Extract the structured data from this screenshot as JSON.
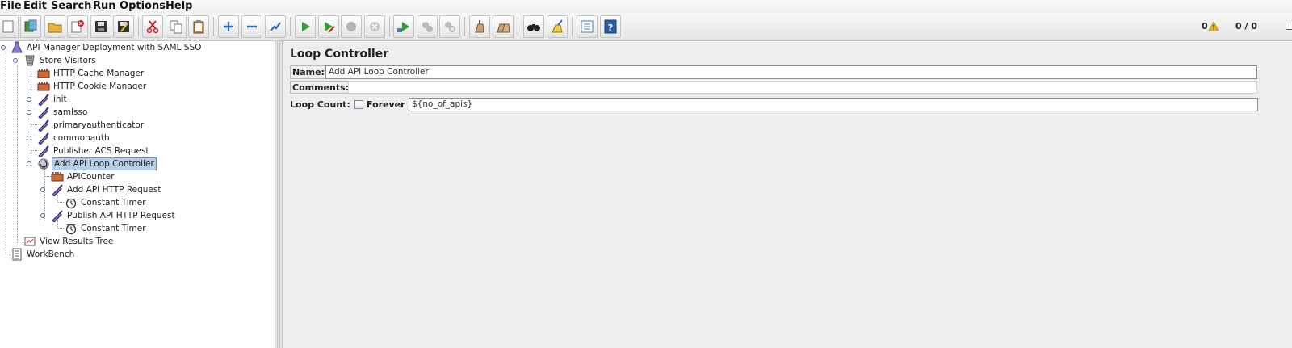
{
  "menu": [
    {
      "mnemonic": "F",
      "rest": "ile"
    },
    {
      "mnemonic": "E",
      "rest": "dit"
    },
    {
      "mnemonic": "S",
      "rest": "earch"
    },
    {
      "mnemonic": "R",
      "rest": "un"
    },
    {
      "mnemonic": "O",
      "rest": "ptions"
    },
    {
      "mnemonic": "H",
      "rest": "elp"
    }
  ],
  "toolbar": {
    "buttons": [
      "new-icon",
      "templates-icon",
      "open-icon",
      "close-icon",
      "save-icon",
      "save-as-icon",
      "cut-icon",
      "copy-icon",
      "paste-icon",
      "expand-icon",
      "collapse-icon",
      "toggle-icon",
      "start-icon",
      "start-no-pause-icon",
      "stop-icon",
      "shutdown-icon",
      "remote-start-icon",
      "remote-stop-icon",
      "remote-shutdown-icon",
      "clear-icon",
      "clear-all-icon",
      "search-icon",
      "reset-search-icon",
      "function-helper-icon",
      "help-icon"
    ],
    "errors_count": "0",
    "threads": "0 / 0"
  },
  "tree": {
    "nodes": [
      {
        "label": "API Manager Deployment with SAML SSO",
        "icon": "test-plan-icon"
      },
      {
        "label": "Store Visitors",
        "icon": "thread-group-icon"
      },
      {
        "label": "HTTP Cache Manager",
        "icon": "config-element-icon"
      },
      {
        "label": "HTTP Cookie Manager",
        "icon": "config-element-icon"
      },
      {
        "label": "init",
        "icon": "sampler-icon"
      },
      {
        "label": "samlsso",
        "icon": "sampler-icon"
      },
      {
        "label": "primaryauthenticator",
        "icon": "sampler-icon"
      },
      {
        "label": "commonauth",
        "icon": "sampler-icon"
      },
      {
        "label": "Publisher ACS Request",
        "icon": "sampler-icon"
      },
      {
        "label": "Add API Loop Controller",
        "icon": "loop-controller-icon"
      },
      {
        "label": "APICounter",
        "icon": "config-element-icon"
      },
      {
        "label": "Add API HTTP Request",
        "icon": "sampler-icon"
      },
      {
        "label": "Constant Timer",
        "icon": "timer-icon"
      },
      {
        "label": "Publish API HTTP Request",
        "icon": "sampler-icon"
      },
      {
        "label": "Constant Timer",
        "icon": "timer-icon"
      },
      {
        "label": "View Results Tree",
        "icon": "listener-icon"
      },
      {
        "label": "WorkBench",
        "icon": "workbench-icon"
      }
    ],
    "selected_index": 9
  },
  "panel": {
    "title": "Loop Controller",
    "name_label": "Name:",
    "name_value": "Add API Loop Controller",
    "comments_label": "Comments:",
    "comments_value": "",
    "loop_count_label": "Loop Count:",
    "forever_label": "Forever",
    "forever_checked": false,
    "loop_count_value": "${no_of_apis}"
  }
}
